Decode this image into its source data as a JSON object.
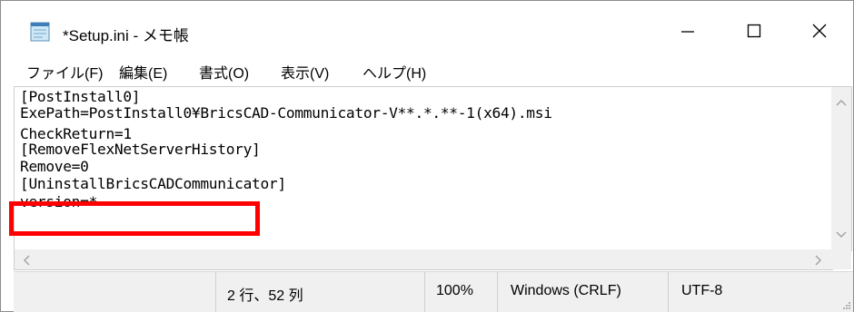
{
  "window": {
    "title": "*Setup.ini - メモ帳",
    "icon": "notepad-icon",
    "controls": {
      "minimize_icon": "minimize-icon",
      "maximize_icon": "maximize-icon",
      "close_icon": "close-icon"
    }
  },
  "menu": {
    "items": [
      {
        "label": "ファイル(F)"
      },
      {
        "label": "編集(E)"
      },
      {
        "label": "書式(O)"
      },
      {
        "label": "表示(V)"
      },
      {
        "label": "ヘルプ(H)"
      }
    ]
  },
  "editor": {
    "lines": [
      "[PostInstall0]",
      "ExePath=PostInstall0¥BricsCAD-Communicator-V**.*.**-1(x64).msi",
      "CheckReturn=1",
      "[RemoveFlexNetServerHistory]",
      "Remove=0",
      "[UninstallBricsCADCommunicator]",
      "version=*"
    ],
    "highlight_color": "#ff0000"
  },
  "statusbar": {
    "position": "2 行、52 列",
    "zoom": "100%",
    "line_ending": "Windows (CRLF)",
    "encoding": "UTF-8"
  }
}
